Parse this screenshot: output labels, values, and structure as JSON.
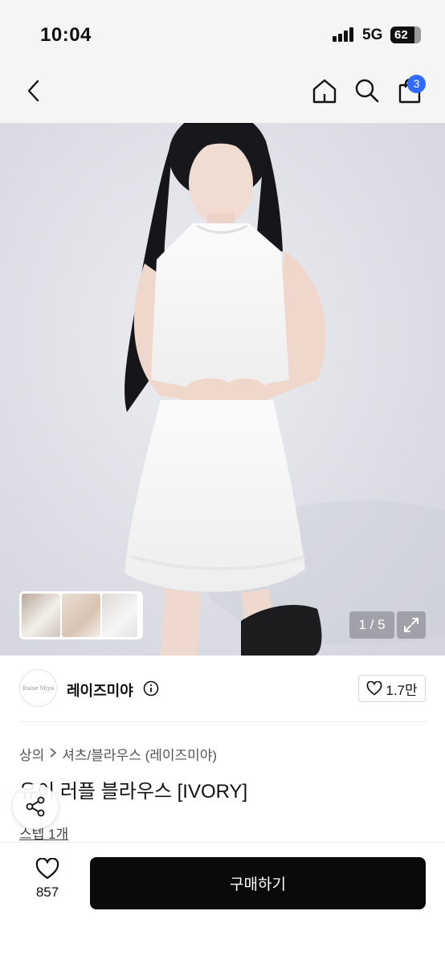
{
  "status": {
    "time": "10:04",
    "network": "5G",
    "battery": "62"
  },
  "nav": {
    "cart_count": "3"
  },
  "gallery": {
    "page_indicator": "1 / 5"
  },
  "shop": {
    "logo_text": "Raise Miya",
    "name": "레이즈미야",
    "likes": "1.7만"
  },
  "product": {
    "breadcrumb": [
      "상의",
      "셔츠/블라우스 (레이즈미야)"
    ],
    "title": "유이 러플 블라우스 [IVORY]",
    "shop_link": "스텝 1개"
  },
  "bottom": {
    "like_count": "857",
    "buy_label": "구매하기"
  },
  "colors": {
    "accent": "#2f6bff",
    "buy_button": "#0a0a0a"
  }
}
